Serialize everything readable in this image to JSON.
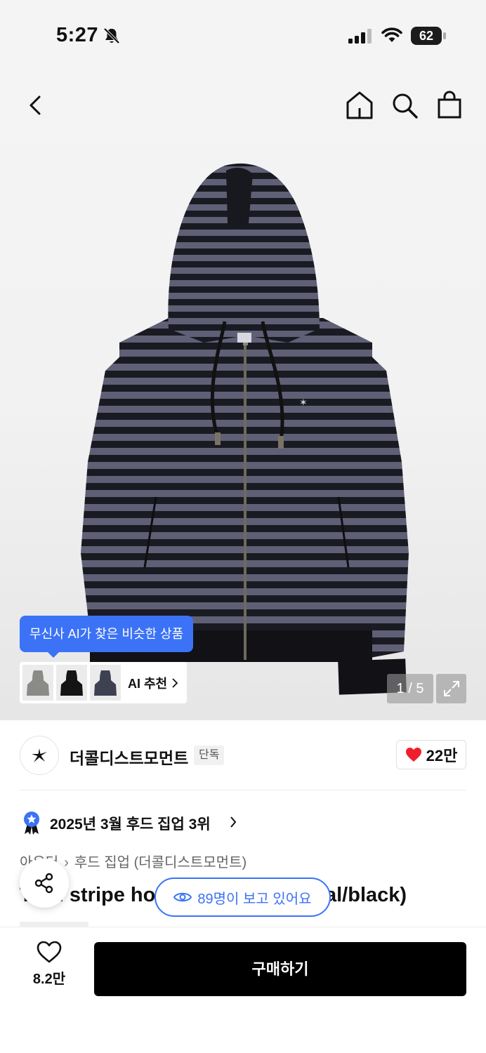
{
  "status_bar": {
    "time": "5:27",
    "battery": "62"
  },
  "ai": {
    "tooltip": "무신사 AI가 찾은 비슷한 상품",
    "recommend_label": "AI 추천"
  },
  "gallery": {
    "counter": "1 / 5"
  },
  "brand": {
    "name": "더콜디스트모먼트",
    "badge": "단독",
    "likes": "22만"
  },
  "ranking": {
    "text": "2025년 3월 후드 집업 3위"
  },
  "breadcrumb": {
    "category": "아우터",
    "subcategory": "후드 집업 (더콜디스트모먼트)"
  },
  "product": {
    "title": "TCM stripe hood zip-up (charcoal/black)"
  },
  "viewers": {
    "text": "89명이 보고 있어요"
  },
  "bottom_bar": {
    "wish_count": "8.2만",
    "buy_label": "구매하기"
  },
  "colors": {
    "accent_blue": "#3b72f6",
    "heart_red": "#f01e2c",
    "buy_black": "#000000"
  }
}
